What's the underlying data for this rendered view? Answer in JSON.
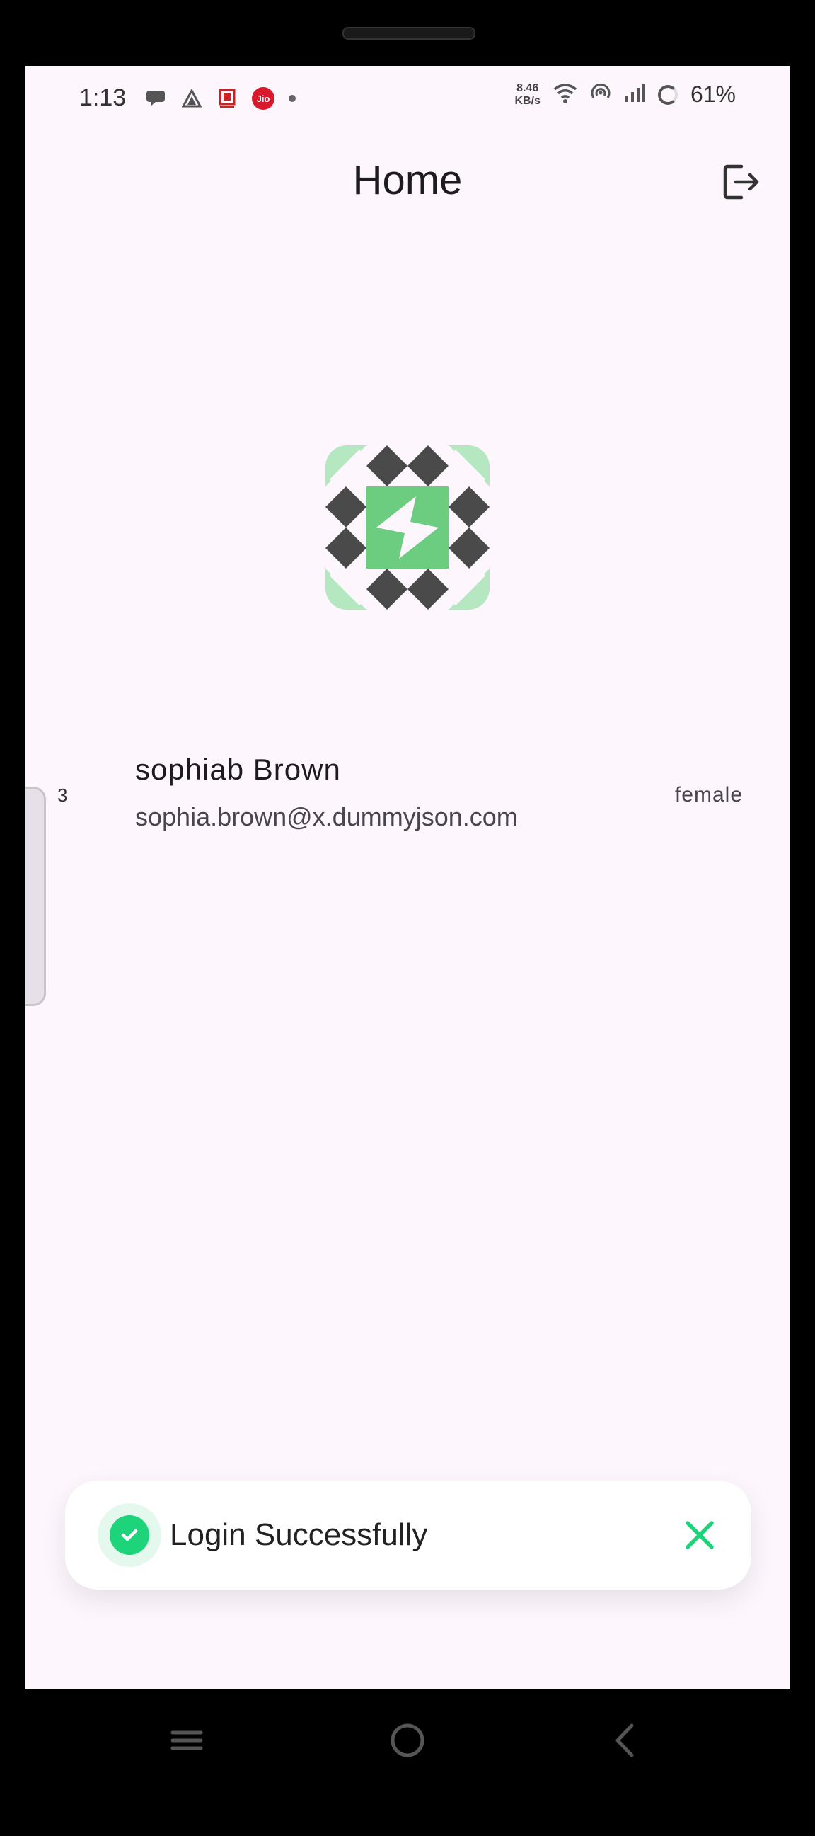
{
  "status_bar": {
    "time": "1:13",
    "jio_label": "Jio",
    "net_speed_value": "8.46",
    "net_speed_unit": "KB/s",
    "battery": "61%",
    "icons": [
      "chat-bubble-icon",
      "signal-triangle-icon",
      "app-icon",
      "jio-icon",
      "dot-icon",
      "wifi-icon",
      "hotspot-icon",
      "cell-signal-icon",
      "battery-icon"
    ]
  },
  "appbar": {
    "title": "Home",
    "action_icon": "logout-icon"
  },
  "user": {
    "index": "3",
    "name": "sophiab Brown",
    "email": "sophia.brown@x.dummyjson.com",
    "gender": "female",
    "avatar_icon": "identicon-avatar"
  },
  "toast": {
    "message": "Login Successfully",
    "icon": "check-circle-icon",
    "close_icon": "close-icon"
  },
  "navigation": {
    "buttons": [
      "recents-icon",
      "home-icon",
      "back-icon"
    ]
  },
  "colors": {
    "background": "#fdf6fd",
    "success": "#1ed47a",
    "avatar_green": "#6ccc80",
    "avatar_dark": "#4a4a4a"
  }
}
